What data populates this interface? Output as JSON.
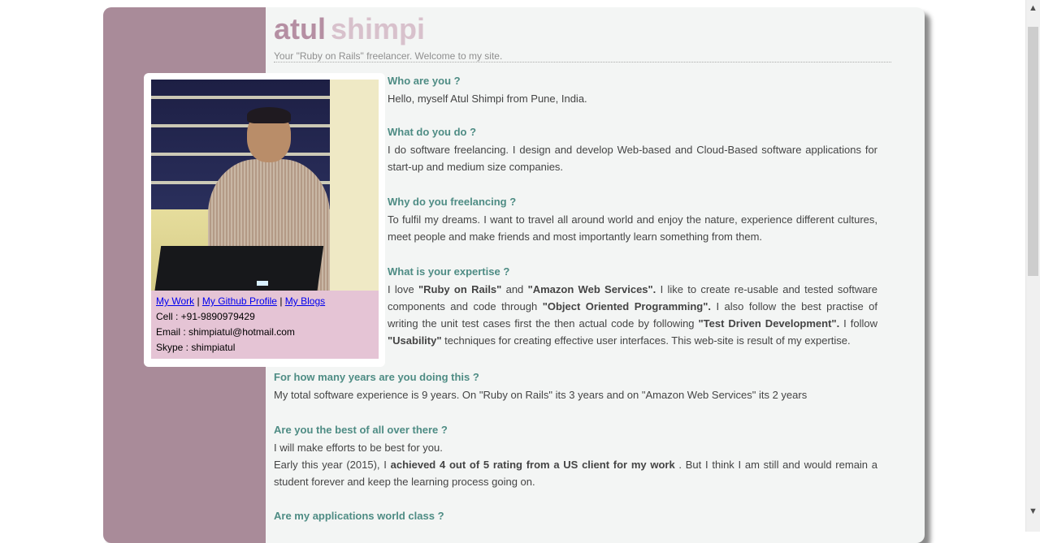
{
  "header": {
    "title_first": "atul",
    "title_last": "shimpi",
    "tagline": "Your \"Ruby on Rails\" freelancer. Welcome to my site."
  },
  "profile": {
    "photo_alt": "profile-photo",
    "links": {
      "work": "My Work",
      "github": "My Github Profile",
      "blogs": "My Blogs",
      "separator": "|"
    },
    "cell": "Cell : +91-9890979429",
    "email": "Email : shimpiatul@hotmail.com",
    "skype": "Skype : shimpiatul"
  },
  "qa": [
    {
      "question": "Who are you ?",
      "answer": "Hello, myself Atul Shimpi from Pune, India."
    },
    {
      "question": "What do you do ?",
      "answer": "I do software freelancing. I design and develop Web-based and Cloud-Based software applications for start-up and medium size companies."
    },
    {
      "question": "Why do you freelancing ?",
      "answer": "To fulfil my dreams. I want to travel all around world and enjoy the nature, experience different cultures, meet people and make friends and most importantly learn something from them."
    },
    {
      "question": "What is your expertise ?",
      "answer_parts": [
        "I love ",
        "\"Ruby on Rails\"",
        " and ",
        "\"Amazon Web Services\".",
        " I like to create re-usable and tested software components and code through ",
        "\"Object Oriented Programming\".",
        " I also follow the best practise of writing the unit test cases first the then actual code by following ",
        "\"Test Driven Development\".",
        " I follow ",
        "\"Usability\"",
        " techniques for creating effective user interfaces. This web-site is result of my expertise."
      ]
    },
    {
      "question": "For how many years are you doing this ?",
      "answer": "My total software experience is 9 years. On \"Ruby on Rails\" its 3 years and on \"Amazon Web Services\" its 2 years"
    },
    {
      "question": "Are you the best of all over there ?",
      "answer": "I will make efforts to be best for you.",
      "answer2_parts": [
        "Early this year (2015), I ",
        "achieved 4 out of 5 rating from a US client for my work",
        " . But I think I am still and would remain a student forever and keep the learning process going on."
      ]
    },
    {
      "question": "Are my applications world class ?"
    }
  ],
  "colors": {
    "sidebar": "#a98b99",
    "contact_bg": "#e5c4d5",
    "question": "#4e8c84",
    "title_first": "#b58fa3",
    "title_last": "#d8c1cc"
  },
  "icons": {
    "scroll_up": "▲",
    "scroll_down": "▼"
  }
}
